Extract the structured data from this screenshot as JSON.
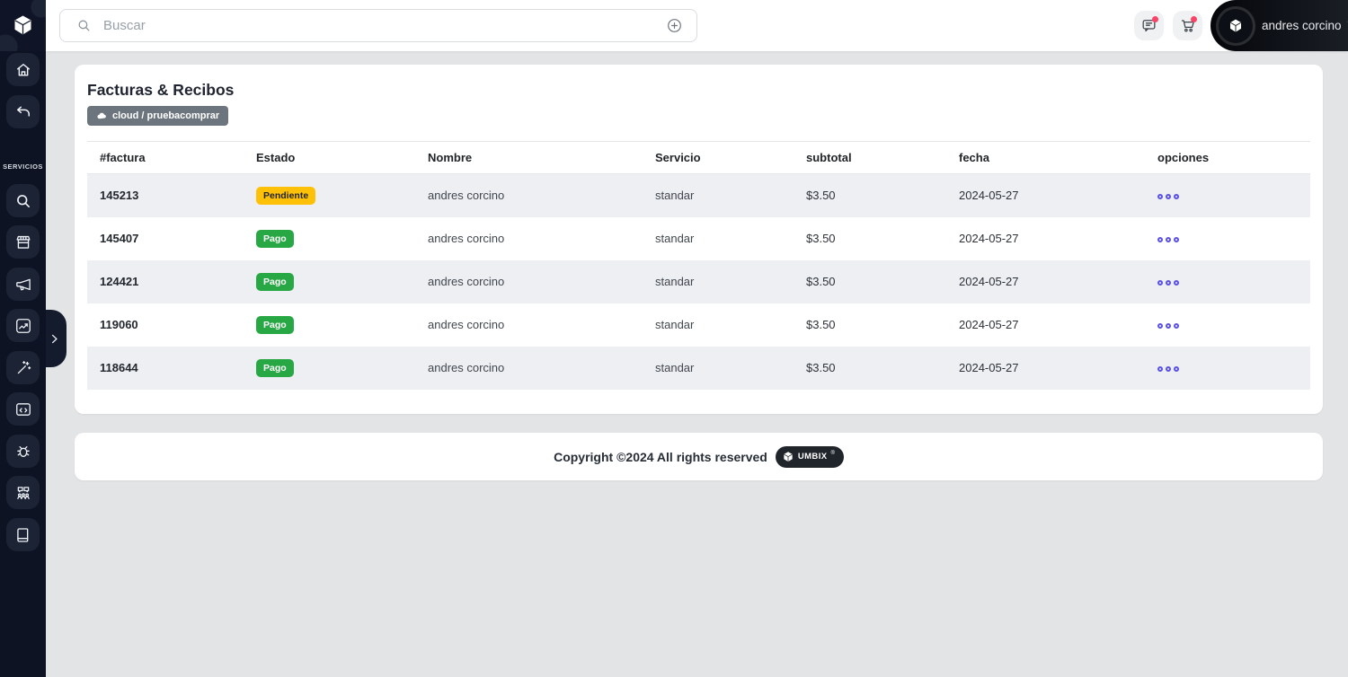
{
  "theme": {
    "sidebar_bg": "#0d1322",
    "accent_options": "#5a51e4",
    "notification_dot": "#fb4367",
    "badge_breadcrumb_bg": "#6c757d",
    "warning_bg": "#ffc107",
    "success_bg": "#28a745"
  },
  "sidebar": {
    "logo_icon": "cube-logo",
    "top_items": [
      {
        "icon": "home-icon"
      },
      {
        "icon": "undo-icon"
      }
    ],
    "section_label": "SERVICIOS",
    "service_items": [
      {
        "icon": "search-icon"
      },
      {
        "icon": "store-icon"
      },
      {
        "icon": "megaphone-icon"
      },
      {
        "icon": "chart-icon"
      },
      {
        "icon": "magic-wand-icon"
      },
      {
        "icon": "code-window-icon"
      },
      {
        "icon": "bug-icon"
      },
      {
        "icon": "community-icon"
      },
      {
        "icon": "book-icon"
      }
    ],
    "expand_icon": "chevron-right-icon"
  },
  "topbar": {
    "search": {
      "placeholder": "Buscar",
      "value": "",
      "left_icon": "search-icon",
      "right_icon": "plus-circle-icon"
    },
    "actions": [
      {
        "icon": "chat-icon",
        "has_notification": true
      },
      {
        "icon": "cart-icon",
        "has_notification": true
      }
    ],
    "user": {
      "name": "andres corcino",
      "avatar_icon": "cube-logo",
      "chevron": "chevron-down-icon"
    }
  },
  "page": {
    "title": "Facturas & Recibos",
    "breadcrumb_badge": {
      "icon": "cloud-icon",
      "label": "cloud / pruebacomprar"
    }
  },
  "table": {
    "columns": [
      "#factura",
      "Estado",
      "Nombre",
      "Servicio",
      "subtotal",
      "fecha",
      "opciones"
    ],
    "rows": [
      {
        "factura": "145213",
        "estado": "Pendiente",
        "estado_bg": "#ffc107",
        "estado_fg": "#212529",
        "nombre": "andres corcino",
        "servicio": "standar",
        "subtotal": "$3.50",
        "fecha": "2024-05-27"
      },
      {
        "factura": "145407",
        "estado": "Pago",
        "estado_bg": "#28a745",
        "estado_fg": "#ffffff",
        "nombre": "andres corcino",
        "servicio": "standar",
        "subtotal": "$3.50",
        "fecha": "2024-05-27"
      },
      {
        "factura": "124421",
        "estado": "Pago",
        "estado_bg": "#28a745",
        "estado_fg": "#ffffff",
        "nombre": "andres corcino",
        "servicio": "standar",
        "subtotal": "$3.50",
        "fecha": "2024-05-27"
      },
      {
        "factura": "119060",
        "estado": "Pago",
        "estado_bg": "#28a745",
        "estado_fg": "#ffffff",
        "nombre": "andres corcino",
        "servicio": "standar",
        "subtotal": "$3.50",
        "fecha": "2024-05-27"
      },
      {
        "factura": "118644",
        "estado": "Pago",
        "estado_bg": "#28a745",
        "estado_fg": "#ffffff",
        "nombre": "andres corcino",
        "servicio": "standar",
        "subtotal": "$3.50",
        "fecha": "2024-05-27"
      }
    ]
  },
  "footer": {
    "text": "Copyright ©2024 All rights reserved",
    "brand": "UMBIX",
    "brand_mark": "®"
  }
}
